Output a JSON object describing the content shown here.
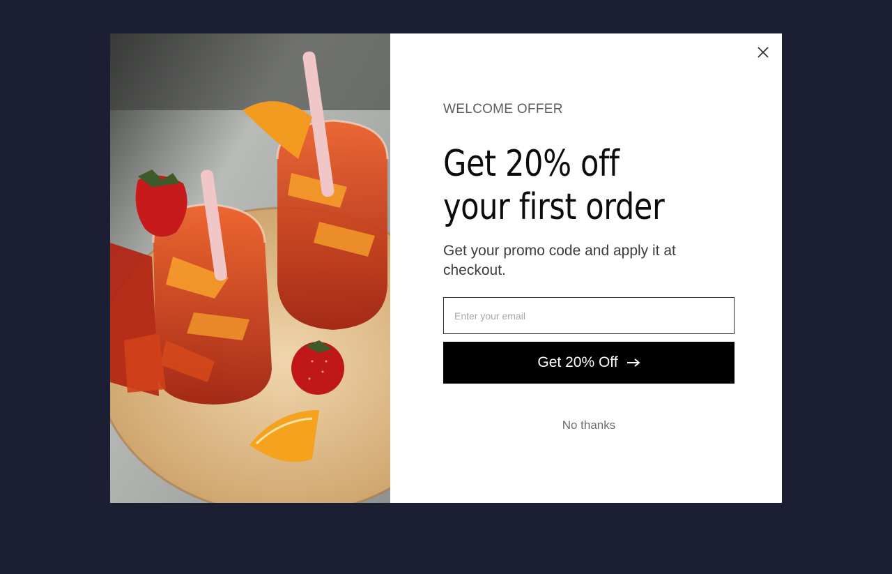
{
  "modal": {
    "image_alt": "Two glasses of sangria with orange slices, strawberries and straws on a wooden board",
    "eyebrow": "WELCOME OFFER",
    "headline_line1": "Get 20% off",
    "headline_line2": "your first order",
    "subtext": "Get your promo code and apply it at checkout.",
    "email_placeholder": "Enter your email",
    "email_value": "",
    "cta_label": "Get 20% Off",
    "cta_icon": "arrow-right-icon",
    "dismiss_label": "No thanks",
    "close_icon": "close-icon"
  },
  "colors": {
    "page_background": "#1c1f33",
    "modal_background": "#ffffff",
    "cta_background": "#000000",
    "cta_text": "#ffffff"
  }
}
